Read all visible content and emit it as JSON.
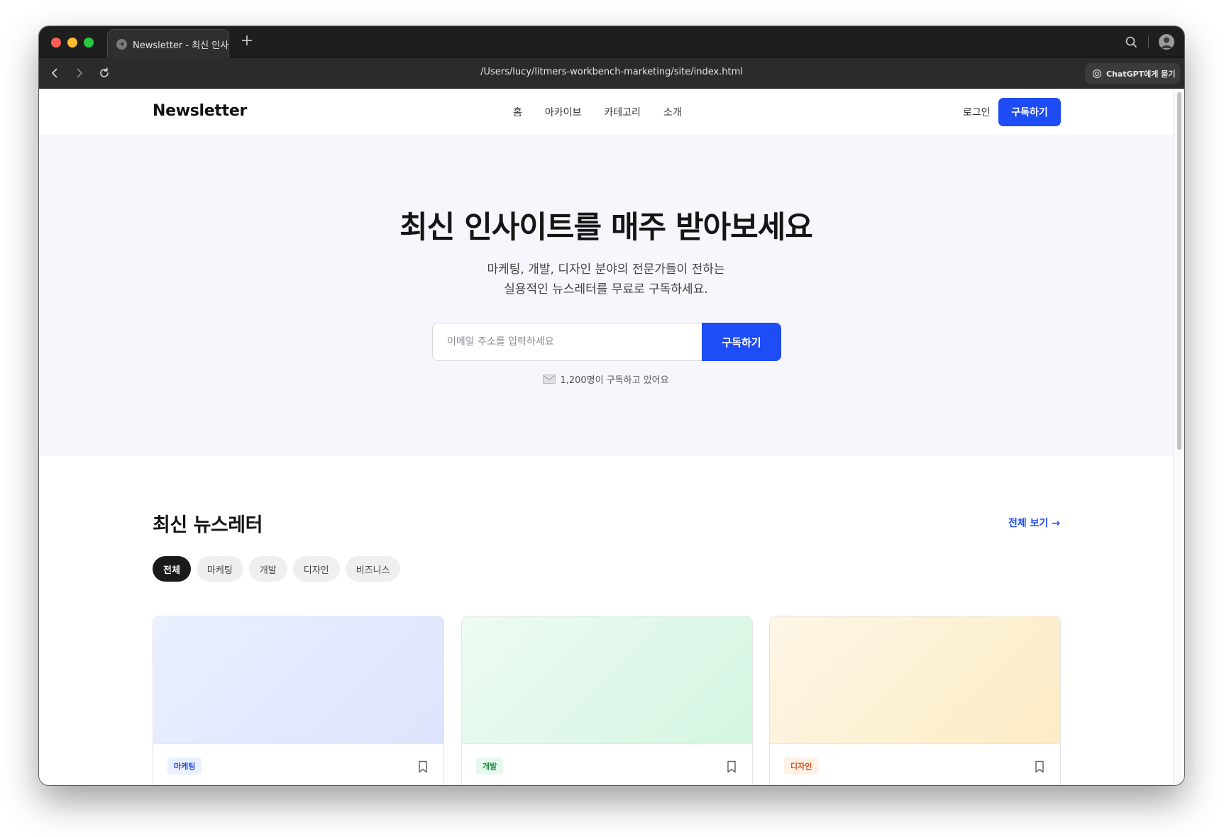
{
  "browser": {
    "tab_title": "Newsletter - 최신 인사",
    "url": "/Users/lucy/litmers-workbench-marketing/site/index.html",
    "chatgpt_label": "ChatGPT에게 묻기"
  },
  "header": {
    "logo": "Newsletter",
    "nav": [
      "홈",
      "아카이브",
      "카테고리",
      "소개"
    ],
    "login": "로그인",
    "subscribe": "구독하기"
  },
  "hero": {
    "title": "최신 인사이트를 매주 받아보세요",
    "desc_line1": "마케팅, 개발, 디자인 분야의 전문가들이 전하는",
    "desc_line2": "실용적인 뉴스레터를 무료로 구독하세요.",
    "input_placeholder": "이메일 주소를 입력하세요",
    "button": "구독하기",
    "subscriber_count": "1,200명이 구독하고 있어요"
  },
  "latest": {
    "title": "최신 뉴스레터",
    "view_all": "전체 보기 →",
    "filters": [
      "전체",
      "마케팅",
      "개발",
      "디자인",
      "비즈니스"
    ],
    "active_filter": "전체",
    "cards": [
      {
        "tag": "마케팅"
      },
      {
        "tag": "개발"
      },
      {
        "tag": "디자인"
      }
    ]
  },
  "colors": {
    "accent": "#1e4cf5",
    "hero_bg": "#f6f6fc"
  }
}
